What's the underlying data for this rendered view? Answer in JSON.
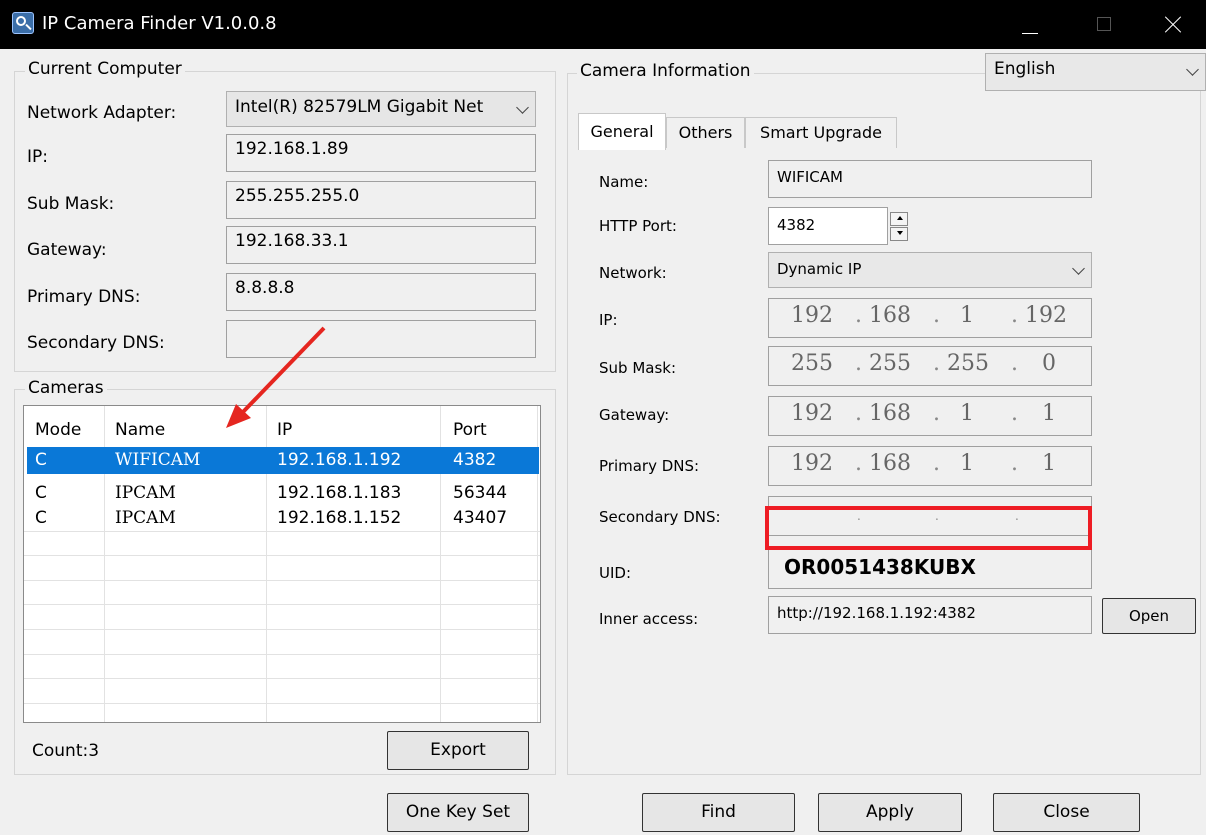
{
  "window": {
    "title": "IP Camera Finder V1.0.0.8",
    "icon": "magnifier-icon"
  },
  "current_computer": {
    "legend": "Current Computer",
    "network_adapter_label": "Network Adapter:",
    "network_adapter_value": "Intel(R) 82579LM Gigabit Net",
    "ip_label": "IP:",
    "ip_value": "192.168.1.89",
    "sub_mask_label": "Sub Mask:",
    "sub_mask_value": "255.255.255.0",
    "gateway_label": "Gateway:",
    "gateway_value": "192.168.33.1",
    "primary_dns_label": "Primary DNS:",
    "primary_dns_value": "8.8.8.8",
    "secondary_dns_label": "Secondary DNS:",
    "secondary_dns_value": ""
  },
  "cameras": {
    "legend": "Cameras",
    "columns": [
      "Mode",
      "Name",
      "IP",
      "Port"
    ],
    "rows": [
      {
        "mode": "C",
        "name": "WIFICAM",
        "ip": "192.168.1.192",
        "port": "4382",
        "selected": true
      },
      {
        "mode": "C",
        "name": "IPCAM",
        "ip": "192.168.1.183",
        "port": "56344",
        "selected": false
      },
      {
        "mode": "C",
        "name": "IPCAM",
        "ip": "192.168.1.152",
        "port": "43407",
        "selected": false
      }
    ],
    "count_label": "Count:3",
    "export_label": "Export"
  },
  "camera_info": {
    "legend": "Camera Information",
    "language": "English",
    "tabs": [
      "General",
      "Others",
      "Smart Upgrade"
    ],
    "active_tab": "General",
    "name_label": "Name:",
    "name_value": "WIFICAM",
    "http_port_label": "HTTP Port:",
    "http_port_value": "4382",
    "network_label": "Network:",
    "network_value": "Dynamic IP",
    "ip_label": "IP:",
    "ip_octets": [
      "192",
      "168",
      "1",
      "192"
    ],
    "sub_mask_label": "Sub Mask:",
    "sub_mask_octets": [
      "255",
      "255",
      "255",
      "0"
    ],
    "gateway_label": "Gateway:",
    "gateway_octets": [
      "192",
      "168",
      "1",
      "1"
    ],
    "primary_dns_label": "Primary DNS:",
    "primary_dns_octets": [
      "192",
      "168",
      "1",
      "1"
    ],
    "secondary_dns_label": "Secondary DNS:",
    "secondary_dns_octets": [
      "",
      "",
      "",
      ""
    ],
    "uid_label": "UID:",
    "uid_value": "OR0051438KUBX",
    "inner_access_label": "Inner access:",
    "inner_access_value": "http://192.168.1.192:4382",
    "open_label": "Open"
  },
  "buttons": {
    "one_key_set": "One Key Set",
    "find": "Find",
    "apply": "Apply",
    "close": "Close"
  },
  "annotations": {
    "arrow_color": "#e52620",
    "highlight_color": "#ee1c24"
  }
}
